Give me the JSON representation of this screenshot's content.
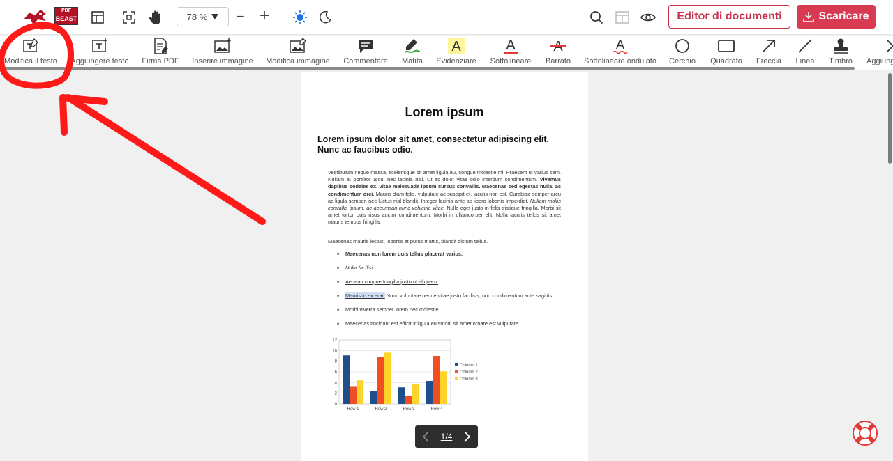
{
  "topbar": {
    "brand_small": "PDF",
    "brand_big": "BEAST",
    "zoom_value": "78 %",
    "zoom_minus": "−",
    "zoom_plus": "+",
    "editor_label": "Editor di documenti",
    "download_label": "Scaricare",
    "icons": [
      "layout-icon",
      "fullscreen-icon",
      "hand-icon",
      "sun-icon",
      "moon-icon",
      "search-icon",
      "panel-icon",
      "eye-icon"
    ]
  },
  "tools": [
    {
      "label": "Modifica il testo",
      "icon": "edit-text-icon"
    },
    {
      "label": "Aggiungere testo",
      "icon": "add-text-icon"
    },
    {
      "label": "Firma PDF",
      "icon": "sign-pdf-icon"
    },
    {
      "label": "Inserire immagine",
      "icon": "insert-image-icon"
    },
    {
      "label": "Modifica immagine",
      "icon": "edit-image-icon"
    },
    {
      "label": "Commentare",
      "icon": "comment-icon"
    },
    {
      "label": "Matita",
      "icon": "pencil-icon"
    },
    {
      "label": "Evidenziare",
      "icon": "highlight-icon"
    },
    {
      "label": "Sottolineare",
      "icon": "underline-icon"
    },
    {
      "label": "Barrato",
      "icon": "strikethrough-icon"
    },
    {
      "label": "Sottolineare ondulato",
      "icon": "wavy-underline-icon"
    },
    {
      "label": "Cerchio",
      "icon": "circle-icon"
    },
    {
      "label": "Quadrato",
      "icon": "square-icon"
    },
    {
      "label": "Freccia",
      "icon": "arrow-icon"
    },
    {
      "label": "Linea",
      "icon": "line-icon"
    },
    {
      "label": "Timbro",
      "icon": "stamp-icon"
    },
    {
      "label": "Aggiung",
      "icon": "add-more-icon"
    }
  ],
  "document": {
    "title": "Lorem ipsum",
    "heading": "Lorem ipsum dolor sit amet, consectetur adipiscing elit. Nunc ac faucibus odio.",
    "para1_a": "Vestibulum neque massa, scelerisque sit amet ligula eu, congue molestie mi. Praesent ut varius sem. Nullam at porttitor arcu, nec lacinia nisi. Ut ac dolor vitae odio interdum condimentum. ",
    "para1_bold": "Vivamus dapibus sodales ex, vitae malesuada ipsum cursus convallis. Maecenas sed egestas nulla, ac condimentum orci.",
    "para1_b": " Mauris diam felis, vulputate ac suscipit et, iaculis non est. Curabitur semper arcu ac ligula semper, nec luctus nisl blandit. Integer lacinia ante ac libero lobortis imperdiet. ",
    "para1_italic": "Nullam mollis convallis ipsum, ac accumsan nunc vehicula vitae.",
    "para1_c": " Nulla eget justo in felis tristique fringilla. Morbi sit amet tortor quis risus auctor condimentum. Morbi in ullamcorper elit. Nulla iaculis tellus sit amet mauris tempus fringilla.",
    "para2": "Maecenas mauris lectus, lobortis et purus mattis, blandit dictum tellus.",
    "list": {
      "item1": "Maecenas non lorem quis tellus placerat varius.",
      "item2": "Nulla facilisi.",
      "item3": "Aenean congue fringilla justo ut aliquam.",
      "item4_hl": "Mauris id ex erat.",
      "item4_rest": " Nunc vulputate neque vitae justo facilisis, non condimentum ante sagittis.",
      "item5": "Morbi viverra semper lorem nec molestie.",
      "item6": "Maecenas tincidunt est efficitur ligula euismod, sit amet ornare est vulputate"
    }
  },
  "chart_data": {
    "type": "bar",
    "categories": [
      "Row 1",
      "Row 2",
      "Row 3",
      "Row 4"
    ],
    "series": [
      {
        "name": "Column 1",
        "values": [
          9.1,
          2.4,
          3.1,
          4.3
        ],
        "color": "#1f4e8c"
      },
      {
        "name": "Column 2",
        "values": [
          3.2,
          8.8,
          1.5,
          9.0
        ],
        "color": "#f04e23"
      },
      {
        "name": "Column 3",
        "values": [
          4.5,
          9.6,
          3.7,
          6.1
        ],
        "color": "#ffd42a"
      }
    ],
    "ylim": [
      0,
      12
    ],
    "yticks": [
      "0",
      "2",
      "4",
      "6",
      "8",
      "10",
      "12"
    ],
    "grid": true,
    "legend": "right"
  },
  "pager": {
    "page_text": "1/4"
  },
  "colors": {
    "accent": "#d83a52",
    "annotation": "#ff1a1a"
  }
}
